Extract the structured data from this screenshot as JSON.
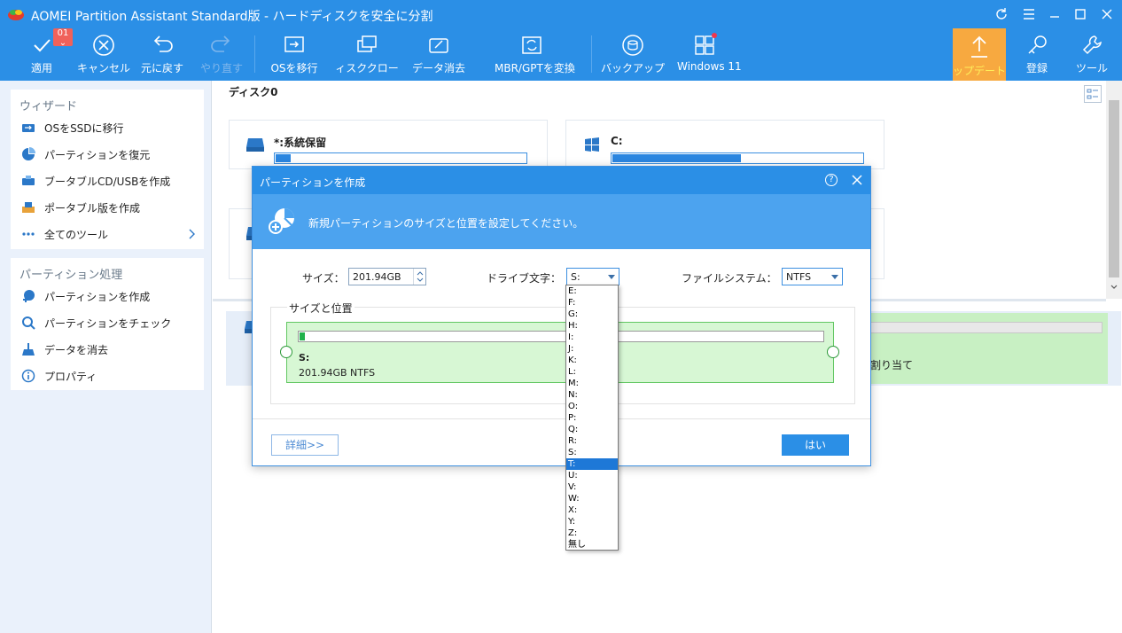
{
  "window": {
    "title": "AOMEI Partition Assistant Standard版 - ハードディスクを安全に分割",
    "colors": {
      "accent": "#2b8fe6",
      "upgrade": "#f7a940",
      "partition": "#d7f7d4",
      "selected": "#1e78d7"
    }
  },
  "toolbar": {
    "badge": "01",
    "apply": "適用",
    "cancel": "キャンセル",
    "undo": "元に戻す",
    "redo": "やり直す",
    "migrate_os": "OSを移行",
    "disk_clone": "ィスククロー",
    "wipe_data": "データ消去",
    "mbr_gpt": "MBR/GPTを変換",
    "backup": "バックアップ",
    "windows11": "Windows 11",
    "upgrade": "ップデート",
    "register": "登録",
    "tools": "ツール"
  },
  "sidebar": {
    "wizard_title": "ウィザード",
    "wizard_items": [
      {
        "label": "OSをSSDに移行",
        "icon": "migrate-os-icon"
      },
      {
        "label": "パーティションを復元",
        "icon": "partition-recovery-icon"
      },
      {
        "label": "ブータブルCD/USBを作成",
        "icon": "bootable-media-icon"
      },
      {
        "label": "ポータブル版を作成",
        "icon": "portable-version-icon"
      },
      {
        "label": "全てのツール",
        "icon": "all-tools-icon"
      }
    ],
    "partition_title": "パーティション処理",
    "partition_items": [
      {
        "label": "パーティションを作成",
        "icon": "create-partition-icon"
      },
      {
        "label": "パーティションをチェック",
        "icon": "check-partition-icon"
      },
      {
        "label": "データを消去",
        "icon": "wipe-data-icon"
      },
      {
        "label": "プロパティ",
        "icon": "info-icon"
      }
    ]
  },
  "main": {
    "disk_label": "ディスク0",
    "cards": [
      {
        "title": "*:系統保留",
        "usage": 0.06
      },
      {
        "title": "C:",
        "usage": 0.51
      }
    ],
    "unallocated_label": "割り当て"
  },
  "dialog": {
    "title": "パーティションを作成",
    "help": "?",
    "banner": "新規パーティションのサイズと位置を設定してください。",
    "size_label": "サイズ：",
    "size_value": "201.94GB",
    "drive_label": "ドライブ文字：",
    "drive_value": "S:",
    "fs_label": "ファイルシステム：",
    "fs_value": "NTFS",
    "group_label": "サイズと位置",
    "partition_letter": "S:",
    "partition_info": "201.94GB NTFS",
    "partition_usage": 0.01,
    "detail_button": "詳細>>",
    "ok_button": "はい"
  },
  "dropdown": {
    "options": [
      "E:",
      "F:",
      "G:",
      "H:",
      "I:",
      "J:",
      "K:",
      "L:",
      "M:",
      "N:",
      "O:",
      "P:",
      "Q:",
      "R:",
      "S:",
      "T:",
      "U:",
      "V:",
      "W:",
      "X:",
      "Y:",
      "Z:",
      "無し"
    ],
    "highlighted": "T:"
  }
}
